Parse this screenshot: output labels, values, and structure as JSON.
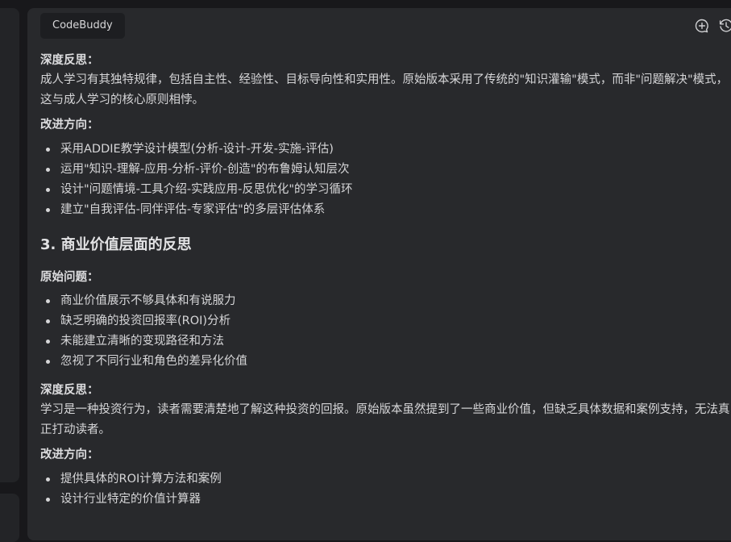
{
  "header": {
    "tab_label": "CodeBuddy",
    "icons": [
      "new-chat-icon",
      "history-icon"
    ]
  },
  "content": {
    "block1": {
      "label": "深度反思：",
      "text": "成人学习有其独特规律，包括自主性、经验性、目标导向性和实用性。原始版本采用了传统的\"知识灌输\"模式，而非\"问题解决\"模式，这与成人学习的核心原则相悖。"
    },
    "block2": {
      "label": "改进方向：",
      "items": [
        "采用ADDIE教学设计模型(分析-设计-开发-实施-评估)",
        "运用\"知识-理解-应用-分析-评价-创造\"的布鲁姆认知层次",
        "设计\"问题情境-工具介绍-实践应用-反思优化\"的学习循环",
        "建立\"自我评估-同伴评估-专家评估\"的多层评估体系"
      ]
    },
    "heading": "3. 商业价值层面的反思",
    "block3": {
      "label": "原始问题：",
      "items": [
        "商业价值展示不够具体和有说服力",
        "缺乏明确的投资回报率(ROI)分析",
        "未能建立清晰的变现路径和方法",
        "忽视了不同行业和角色的差异化价值"
      ]
    },
    "block4": {
      "label": "深度反思：",
      "text": "学习是一种投资行为，读者需要清楚地了解这种投资的回报。原始版本虽然提到了一些商业价值，但缺乏具体数据和案例支持，无法真正打动读者。"
    },
    "block5": {
      "label": "改进方向：",
      "items": [
        "提供具体的ROI计算方法和案例",
        "设计行业特定的价值计算器"
      ]
    }
  },
  "colors": {
    "background": "#18181b",
    "panel": "#28292c",
    "text": "#d6d6d8",
    "chip": "#1d1e21"
  }
}
